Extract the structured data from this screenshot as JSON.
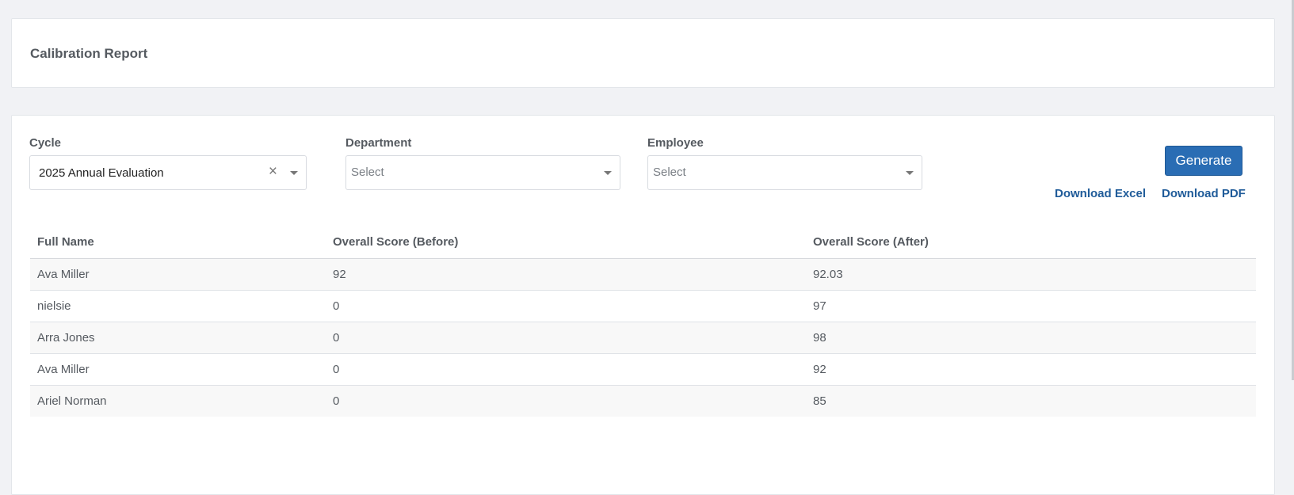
{
  "header": {
    "title": "Calibration Report"
  },
  "filters": {
    "cycle": {
      "label": "Cycle",
      "value": "2025 Annual Evaluation",
      "clear": "×"
    },
    "department": {
      "label": "Department",
      "placeholder": "Select"
    },
    "employee": {
      "label": "Employee",
      "placeholder": "Select"
    }
  },
  "actions": {
    "generate": "Generate",
    "download_excel": "Download Excel",
    "download_pdf": "Download PDF"
  },
  "table": {
    "columns": [
      "Full Name",
      "Overall Score (Before)",
      "Overall Score (After)"
    ],
    "rows": [
      [
        "Ava Miller",
        "92",
        "92.03"
      ],
      [
        "nielsie",
        "0",
        "97"
      ],
      [
        "Arra Jones",
        "0",
        "98"
      ],
      [
        "Ava Miller",
        "0",
        "92"
      ],
      [
        "Ariel Norman",
        "0",
        "85"
      ]
    ]
  }
}
